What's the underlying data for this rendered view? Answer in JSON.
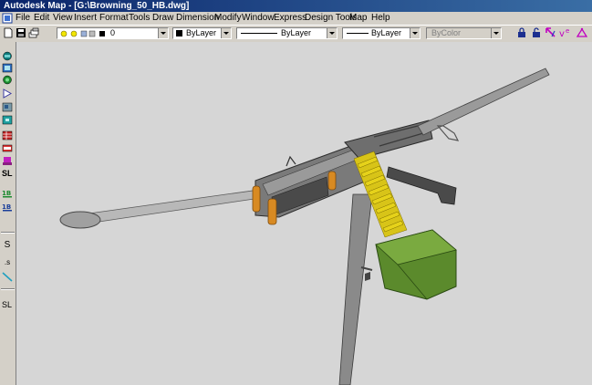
{
  "window": {
    "title": "Autodesk Map - [G:\\Browning_50_HB.dwg]"
  },
  "menu": {
    "items": [
      "File",
      "Edit",
      "View",
      "Insert",
      "Format",
      "Tools",
      "Draw",
      "Dimension",
      "Modify",
      "Window",
      "Express",
      "Design Tools",
      "Map",
      "Help"
    ]
  },
  "toolbar": {
    "layer_value": "0",
    "color_value": "ByLayer",
    "linetype_value": "ByLayer",
    "lineweight_value": "ByLayer",
    "plotstyle_value": "ByColor"
  },
  "sidebar": {
    "sl_label_1": "SL",
    "s_label": "S",
    "dot_s_label": ".s",
    "sl_label_2": "SL"
  },
  "colors": {
    "canvas": "#d6d6d6",
    "ammo_box": "#5b8a2c",
    "rounds": "#e6d21a",
    "handles": "#d88a22",
    "gun_metal": "#5a5a5a"
  }
}
